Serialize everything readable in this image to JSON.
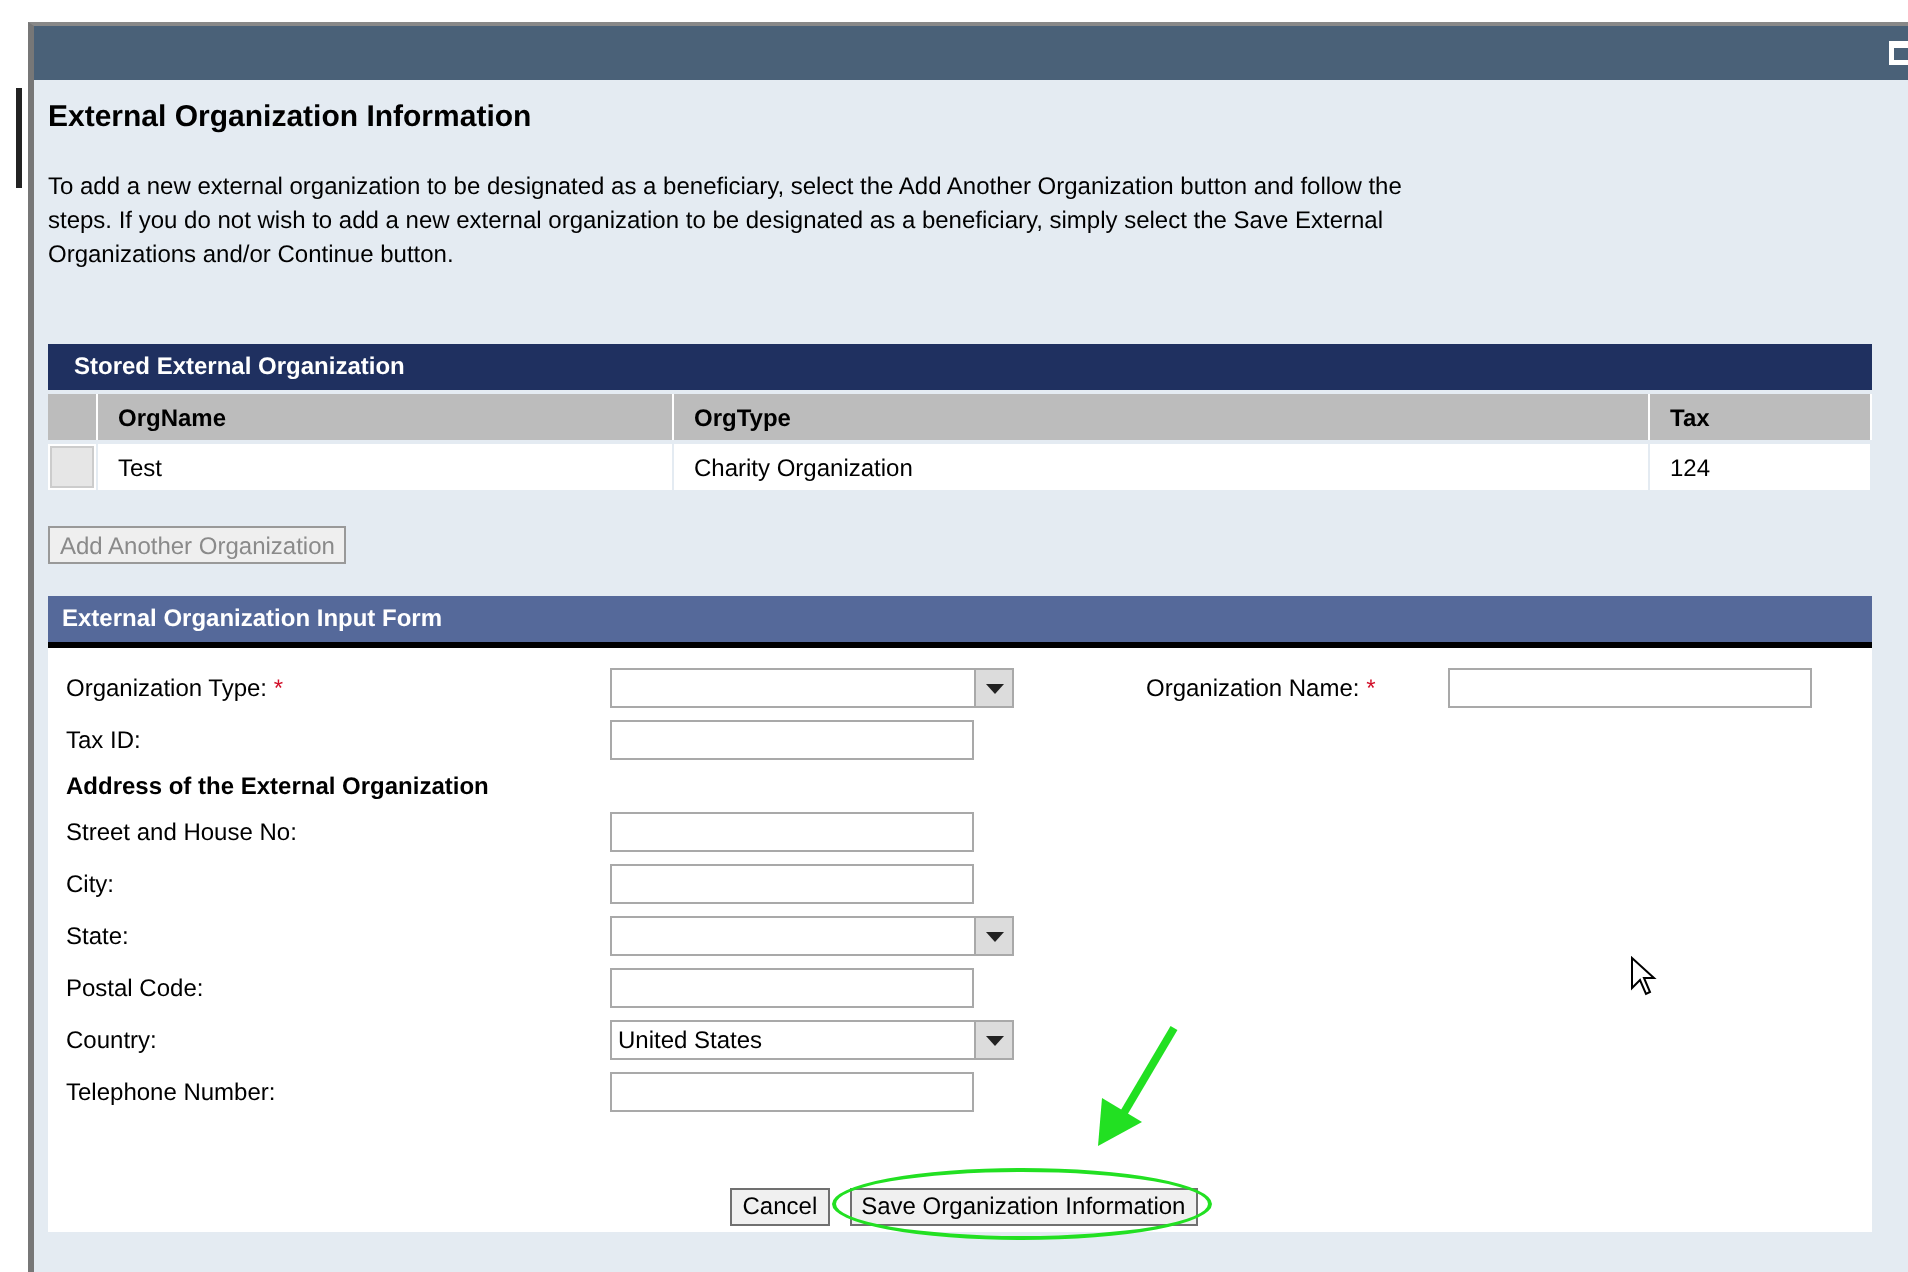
{
  "page": {
    "title": "External Organization Information",
    "intro": "To add a new external organization to be designated as a beneficiary, select the Add Another Organization button and follow the steps.  If you do not wish to add a new external organization to be designated as a beneficiary, simply select the Save External Organizations and/or Continue button."
  },
  "stored_table": {
    "title": "Stored External Organization",
    "columns": [
      "OrgName",
      "OrgType",
      "Tax"
    ],
    "rows": [
      {
        "selected": false,
        "cells": [
          "Test",
          "Charity Organization",
          "124"
        ]
      }
    ]
  },
  "add_button": {
    "label": "Add Another Organization",
    "disabled": true
  },
  "input_form": {
    "title": "External Organization Input Form",
    "required_mark": "*",
    "rows": [
      {
        "kind": "select",
        "label": "Organization Type:",
        "required": true,
        "side": {
          "label": "Organization Name:",
          "required": true
        }
      },
      {
        "kind": "text",
        "label": "Tax ID:"
      },
      {
        "kind": "heading",
        "label": "Address of the External Organization"
      },
      {
        "kind": "text",
        "label": "Street and House No:"
      },
      {
        "kind": "text",
        "label": "City:"
      },
      {
        "kind": "select",
        "label": "State:"
      },
      {
        "kind": "text",
        "label": "Postal Code:"
      },
      {
        "kind": "select",
        "label": "Country:",
        "value": "United States"
      },
      {
        "kind": "text",
        "label": "Telephone Number:"
      }
    ],
    "buttons": [
      {
        "label": "Cancel",
        "highlighted": false
      },
      {
        "label": "Save Organization Information",
        "highlighted": true
      }
    ]
  }
}
